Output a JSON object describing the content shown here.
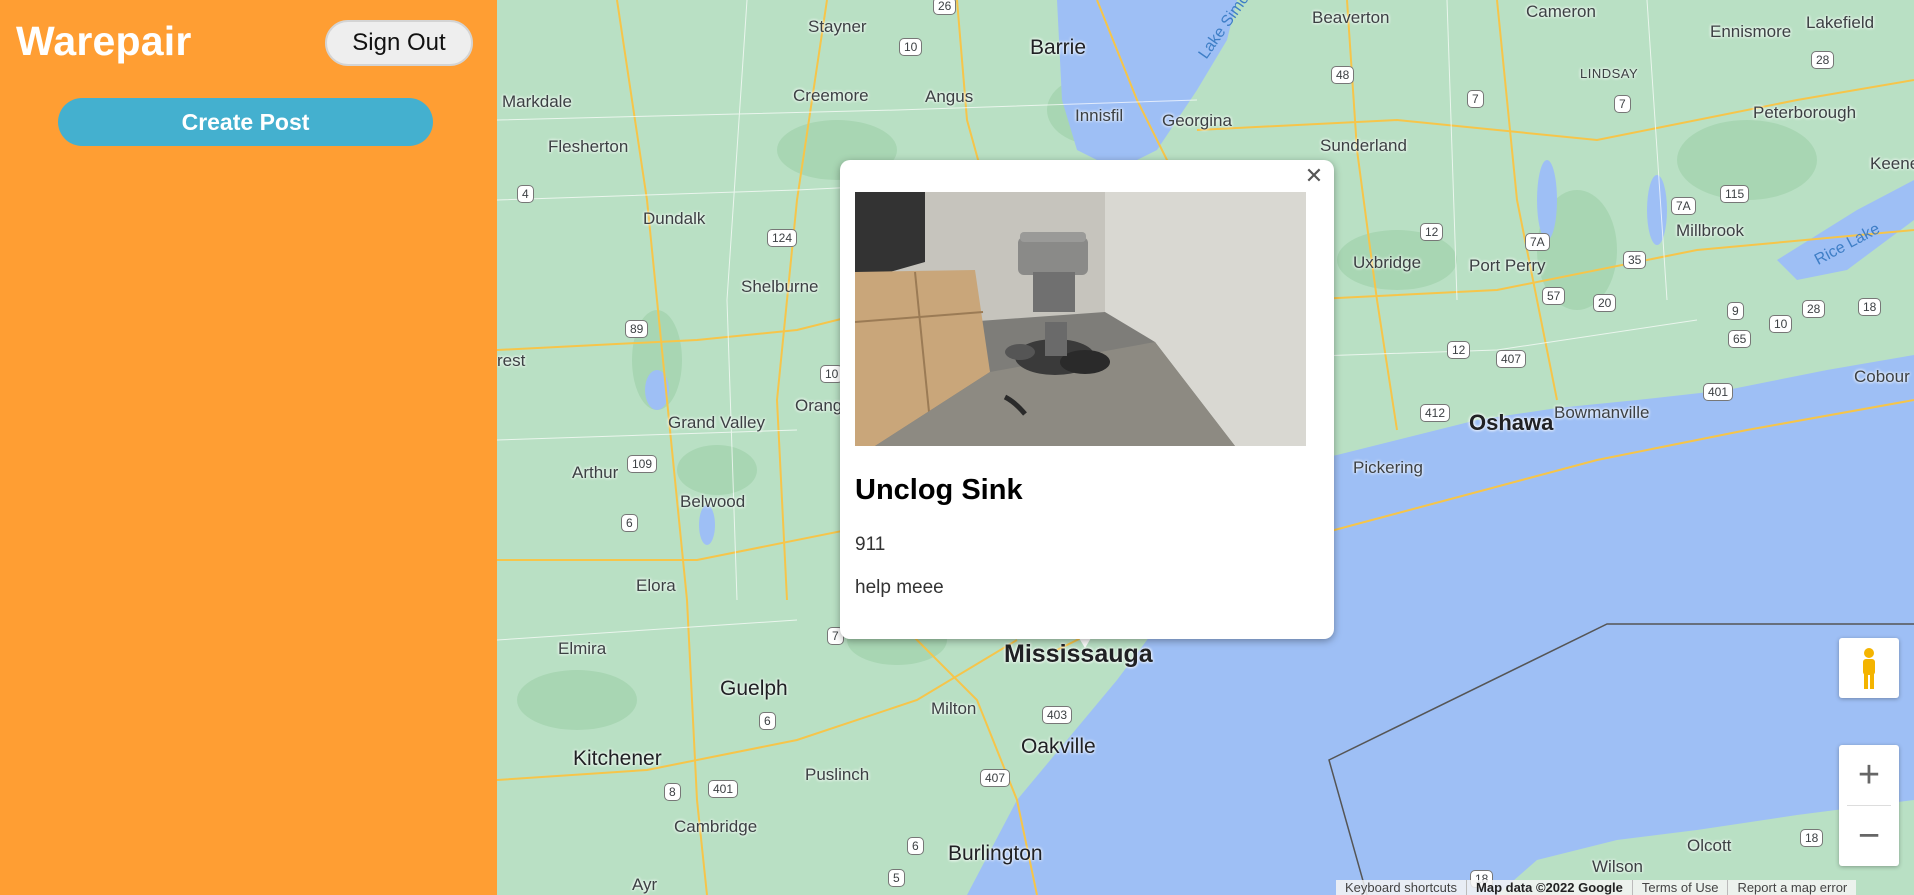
{
  "app": {
    "title": "Warepair",
    "sign_out_label": "Sign Out",
    "create_post_label": "Create Post",
    "brand_color": "#ff9e33",
    "accent_color": "#44b0cf"
  },
  "popup": {
    "close_icon": "close-icon",
    "title": "Unclog Sink",
    "phone": "911",
    "description": "help meee"
  },
  "marker": {
    "close_icon": "close-icon"
  },
  "map": {
    "cities": [
      "Mississauga",
      "Oshawa",
      "Barrie",
      "Guelph",
      "Kitchener",
      "Oakville",
      "Burlington",
      "Cambridge",
      "Milton",
      "Pickering",
      "Peterborough"
    ],
    "towns": [
      "Stayner",
      "Beaverton",
      "Cameron",
      "Ennismore",
      "Lakefield",
      "Markdale",
      "Creemore",
      "Angus",
      "Innisfil",
      "Georgina",
      "Sunderland",
      "Flesherton",
      "Dundalk",
      "Shelburne",
      "Grand Valley",
      "Orang",
      "Arthur",
      "Belwood",
      "Elora",
      "Elmira",
      "Uxbridge",
      "Port Perry",
      "Millbrook",
      "Bowmanville",
      "Puslinch",
      "Ayr",
      "Wilson",
      "Olcott",
      "Cobour",
      "Keene",
      "rest"
    ],
    "lindsay": "LINDSAY",
    "water": [
      "Lake Simc",
      "Rice Lake"
    ],
    "shields": [
      "26",
      "10",
      "48",
      "7",
      "7",
      "28",
      "124",
      "4",
      "12",
      "7A",
      "115",
      "7A",
      "35",
      "89",
      "10",
      "57",
      "20",
      "9",
      "10",
      "28",
      "18",
      "65",
      "12",
      "407",
      "401",
      "109",
      "412",
      "6",
      "7",
      "6",
      "403",
      "401",
      "8",
      "407",
      "6",
      "5",
      "18",
      "18"
    ],
    "zoom_in_label": "+",
    "zoom_out_label": "−",
    "attribution": [
      "Keyboard shortcuts",
      "Map data ©2022 Google",
      "Terms of Use",
      "Report a map error"
    ],
    "water_color": "#9ebff5",
    "land_color": "#b9e0c4"
  }
}
